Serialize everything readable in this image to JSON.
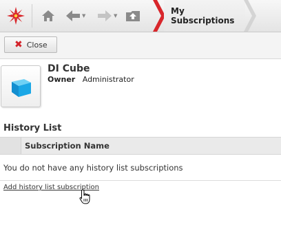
{
  "nav": {
    "logo_icon": "sunburst-logo-icon",
    "home_icon": "home-icon",
    "back_icon": "back-arrow-icon",
    "forward_icon": "forward-arrow-icon",
    "up_icon": "folder-up-icon",
    "breadcrumb_current": "My Subscriptions",
    "accent_color": "#d8262b"
  },
  "toolbar": {
    "close_label": "Close",
    "close_icon": "close-x-icon"
  },
  "object": {
    "name": "DI Cube",
    "owner_label": "Owner",
    "owner_value": "Administrator",
    "icon": "cube-icon"
  },
  "history": {
    "title": "History List",
    "columns": [
      "",
      "Subscription Name"
    ],
    "empty_message": "You do not have any history list subscriptions",
    "add_link": "Add history list subscription"
  }
}
